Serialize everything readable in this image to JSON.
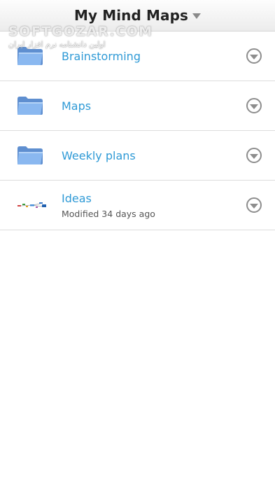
{
  "header": {
    "title": "My Mind Maps"
  },
  "watermark": {
    "main": "SOFTGOZAR.COM",
    "sub": "اولین دانشنامه نرم افزار ایران"
  },
  "items": [
    {
      "label": "Brainstorming",
      "icon": "folder-icon",
      "subtitle": ""
    },
    {
      "label": "Maps",
      "icon": "folder-icon",
      "subtitle": ""
    },
    {
      "label": "Weekly plans",
      "icon": "folder-icon",
      "subtitle": ""
    },
    {
      "label": "Ideas",
      "icon": "mind-map-thumbnail-icon",
      "subtitle": "Modified 34 days ago"
    }
  ],
  "colors": {
    "link": "#2f9ad6",
    "folder": "#7fb0ea"
  }
}
